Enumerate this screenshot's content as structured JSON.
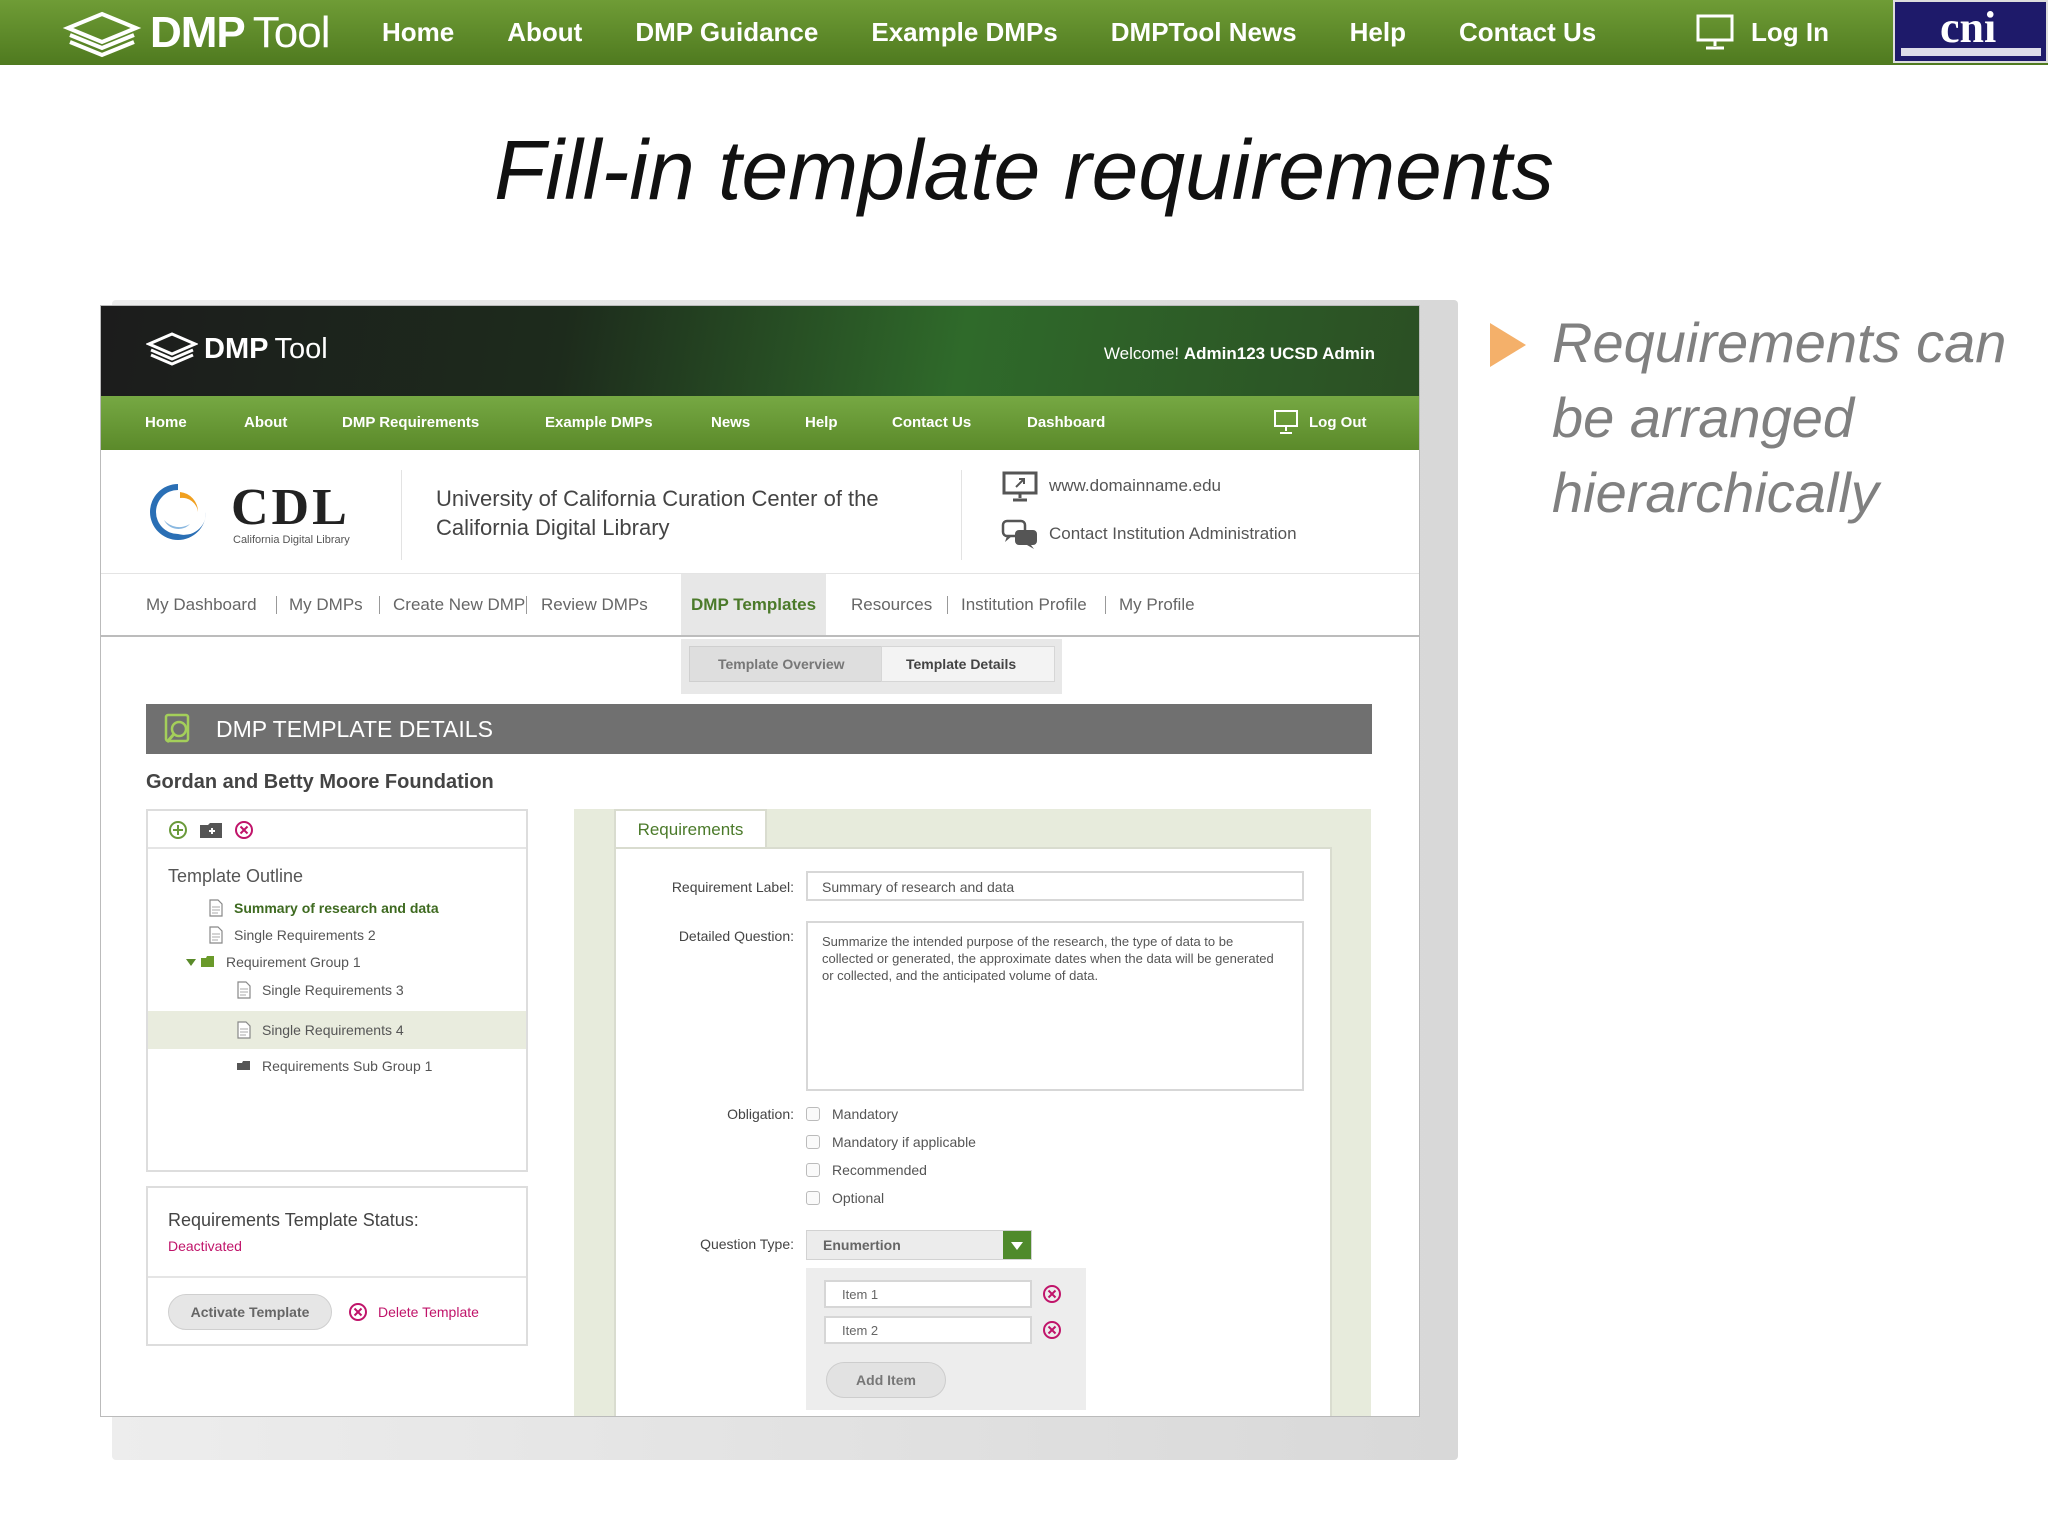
{
  "topbar": {
    "brand_bold": "DMP",
    "brand_light": "Tool",
    "nav": [
      "Home",
      "About",
      "DMP Guidance",
      "Example DMPs",
      "DMPTool News",
      "Help",
      "Contact Us"
    ],
    "login": "Log In",
    "partner_logo": "cni",
    "bg_color": "#5f8c2b"
  },
  "slide": {
    "title": "Fill-in template requirements",
    "bullet": "Requirements can be arranged hierarchically",
    "bullet_color": "#f4b06a"
  },
  "app": {
    "brand_bold": "DMP",
    "brand_light": "Tool",
    "welcome_prefix": "Welcome!",
    "welcome_user": "Admin123 UCSD Admin",
    "nav": [
      "Home",
      "About",
      "DMP Requirements",
      "Example DMPs",
      "News",
      "Help",
      "Contact Us",
      "Dashboard"
    ],
    "logout": "Log Out",
    "institution": {
      "logo_text": "CDL",
      "logo_sub": "California Digital Library",
      "name": "University of California Curation Center of the California Digital Library",
      "website": "www.domainname.edu",
      "contact": "Contact Institution Administration"
    },
    "tabs": [
      "My Dashboard",
      "My DMPs",
      "Create New DMP",
      "Review DMPs",
      "DMP Templates",
      "Resources",
      "Institution Profile",
      "My Profile"
    ],
    "active_tab": "DMP Templates",
    "breadcrumbs": [
      "Template Overview",
      "Template Details"
    ],
    "panel_title": "DMP TEMPLATE DETAILS",
    "funder": "Gordan and Betty Moore Foundation",
    "outline": {
      "title": "Template Outline",
      "items": [
        {
          "label": "Summary of research and data",
          "type": "doc"
        },
        {
          "label": "Single Requirements 2",
          "type": "doc"
        },
        {
          "label": "Requirement Group 1",
          "type": "folder"
        },
        {
          "label": "Single Requirements 3",
          "type": "doc"
        },
        {
          "label": "Single Requirements 4",
          "type": "doc"
        },
        {
          "label": "Requirements Sub Group 1",
          "type": "folder"
        }
      ]
    },
    "status": {
      "label": "Requirements Template Status:",
      "value": "Deactivated",
      "activate_button": "Activate Template",
      "delete_button": "Delete Template"
    },
    "requirements": {
      "tab": "Requirements",
      "label_field": "Requirement Label:",
      "label_value": "Summary of research and data",
      "question_field": "Detailed Question:",
      "question_value": "Summarize the intended purpose of the research, the type of data to be collected or generated, the approximate dates when the data will be generated or collected, and the anticipated volume of data.",
      "obligation_field": "Obligation:",
      "obligation_options": [
        "Mandatory",
        "Mandatory if applicable",
        "Recommended",
        "Optional"
      ],
      "question_type_field": "Question Type:",
      "question_type_value": "Enumertion",
      "enum_items": [
        "Item 1",
        "Item 2"
      ],
      "add_item": "Add Item"
    }
  }
}
